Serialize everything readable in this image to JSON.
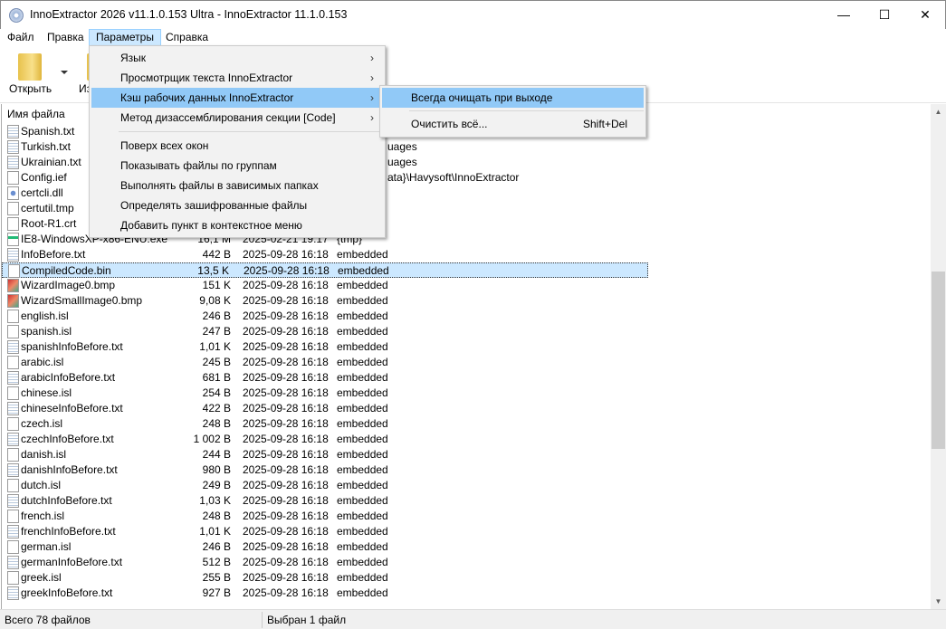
{
  "window": {
    "title": "InnoExtractor 2026 v11.1.0.153 Ultra - InnoExtractor 11.1.0.153",
    "minimize": "—",
    "maximize": "☐",
    "close": "✕"
  },
  "menubar": [
    "Файл",
    "Правка",
    "Параметры",
    "Справка"
  ],
  "toolbar": {
    "open_label": "Открыть",
    "second_label": "Из"
  },
  "list": {
    "header_name": "Имя файла",
    "rows": [
      {
        "name": "Spanish.txt",
        "icon": "txt",
        "size": "",
        "date": "",
        "path": ""
      },
      {
        "name": "Turkish.txt",
        "icon": "txt",
        "size": "",
        "date": "",
        "path": "uages"
      },
      {
        "name": "Ukrainian.txt",
        "icon": "txt",
        "size": "",
        "date": "",
        "path": "uages"
      },
      {
        "name": "Config.ief",
        "icon": "file",
        "size": "",
        "date": "",
        "path": "ata}\\Havysoft\\InnoExtractor"
      },
      {
        "name": "certcli.dll",
        "icon": "dll",
        "size": "",
        "date": "",
        "path": ""
      },
      {
        "name": "certutil.tmp",
        "icon": "file",
        "size": "",
        "date": "",
        "path": ""
      },
      {
        "name": "Root-R1.crt",
        "icon": "file",
        "size": "",
        "date": "",
        "path": ""
      },
      {
        "name": "IE8-WindowsXP-x86-ENU.exe",
        "icon": "exe",
        "size": "16,1 M",
        "date": "2025-02-21 19:17",
        "path": "{tmp}"
      },
      {
        "name": "InfoBefore.txt",
        "icon": "txt",
        "size": "442 B",
        "date": "2025-09-28 16:18",
        "path": "embedded"
      },
      {
        "name": "CompiledCode.bin",
        "icon": "file",
        "size": "13,5 K",
        "date": "2025-09-28 16:18",
        "path": "embedded",
        "selected": true
      },
      {
        "name": "WizardImage0.bmp",
        "icon": "bmp",
        "size": "151 K",
        "date": "2025-09-28 16:18",
        "path": "embedded"
      },
      {
        "name": "WizardSmallImage0.bmp",
        "icon": "bmp",
        "size": "9,08 K",
        "date": "2025-09-28 16:18",
        "path": "embedded"
      },
      {
        "name": "english.isl",
        "icon": "file",
        "size": "246 B",
        "date": "2025-09-28 16:18",
        "path": "embedded"
      },
      {
        "name": "spanish.isl",
        "icon": "file",
        "size": "247 B",
        "date": "2025-09-28 16:18",
        "path": "embedded"
      },
      {
        "name": "spanishInfoBefore.txt",
        "icon": "txt",
        "size": "1,01 K",
        "date": "2025-09-28 16:18",
        "path": "embedded"
      },
      {
        "name": "arabic.isl",
        "icon": "file",
        "size": "245 B",
        "date": "2025-09-28 16:18",
        "path": "embedded"
      },
      {
        "name": "arabicInfoBefore.txt",
        "icon": "txt",
        "size": "681 B",
        "date": "2025-09-28 16:18",
        "path": "embedded"
      },
      {
        "name": "chinese.isl",
        "icon": "file",
        "size": "254 B",
        "date": "2025-09-28 16:18",
        "path": "embedded"
      },
      {
        "name": "chineseInfoBefore.txt",
        "icon": "txt",
        "size": "422 B",
        "date": "2025-09-28 16:18",
        "path": "embedded"
      },
      {
        "name": "czech.isl",
        "icon": "file",
        "size": "248 B",
        "date": "2025-09-28 16:18",
        "path": "embedded"
      },
      {
        "name": "czechInfoBefore.txt",
        "icon": "txt",
        "size": "1 002 B",
        "date": "2025-09-28 16:18",
        "path": "embedded"
      },
      {
        "name": "danish.isl",
        "icon": "file",
        "size": "244 B",
        "date": "2025-09-28 16:18",
        "path": "embedded"
      },
      {
        "name": "danishInfoBefore.txt",
        "icon": "txt",
        "size": "980 B",
        "date": "2025-09-28 16:18",
        "path": "embedded"
      },
      {
        "name": "dutch.isl",
        "icon": "file",
        "size": "249 B",
        "date": "2025-09-28 16:18",
        "path": "embedded"
      },
      {
        "name": "dutchInfoBefore.txt",
        "icon": "txt",
        "size": "1,03 K",
        "date": "2025-09-28 16:18",
        "path": "embedded"
      },
      {
        "name": "french.isl",
        "icon": "file",
        "size": "248 B",
        "date": "2025-09-28 16:18",
        "path": "embedded"
      },
      {
        "name": "frenchInfoBefore.txt",
        "icon": "txt",
        "size": "1,01 K",
        "date": "2025-09-28 16:18",
        "path": "embedded"
      },
      {
        "name": "german.isl",
        "icon": "file",
        "size": "246 B",
        "date": "2025-09-28 16:18",
        "path": "embedded"
      },
      {
        "name": "germanInfoBefore.txt",
        "icon": "txt",
        "size": "512 B",
        "date": "2025-09-28 16:18",
        "path": "embedded"
      },
      {
        "name": "greek.isl",
        "icon": "file",
        "size": "255 B",
        "date": "2025-09-28 16:18",
        "path": "embedded"
      },
      {
        "name": "greekInfoBefore.txt",
        "icon": "txt",
        "size": "927 B",
        "date": "2025-09-28 16:18",
        "path": "embedded"
      }
    ]
  },
  "status": {
    "total": "Всего 78 файлов",
    "selected": "Выбран 1 файл"
  },
  "params_menu": {
    "items": [
      {
        "label": "Язык",
        "submenu": true
      },
      {
        "label": "Просмотрщик текста InnoExtractor",
        "submenu": true
      },
      {
        "label": "Кэш рабочих данных InnoExtractor",
        "submenu": true,
        "highlighted": true
      },
      {
        "label": "Метод дизассемблирования секции [Code]",
        "submenu": true
      },
      {
        "separator": true
      },
      {
        "label": "Поверх всех окон"
      },
      {
        "label": "Показывать файлы по группам"
      },
      {
        "label": "Выполнять файлы в зависимых папках"
      },
      {
        "label": "Определять зашифрованные файлы"
      },
      {
        "label": "Добавить пункт в контекстное меню"
      }
    ]
  },
  "cache_submenu": {
    "items": [
      {
        "label": "Всегда очищать при выходе",
        "shortcut": "",
        "highlighted": true
      },
      {
        "label": "Очистить всё...",
        "shortcut": "Shift+Del"
      }
    ]
  },
  "colors": {
    "selection": "#cce8ff",
    "menu_highlight": "#91c9f7"
  }
}
